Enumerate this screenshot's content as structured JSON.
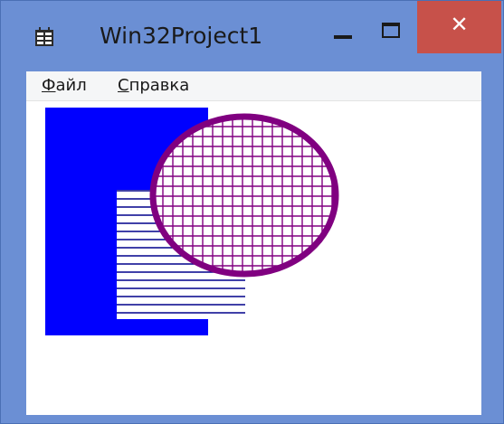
{
  "window": {
    "title": "Win32Project1",
    "icon": "application-icon",
    "controls": {
      "minimize": "minimize-icon",
      "maximize": "maximize-icon",
      "close_glyph": "✕"
    }
  },
  "menu": {
    "items": [
      {
        "mnemonic": "Ф",
        "rest": "айл"
      },
      {
        "mnemonic": "С",
        "rest": "правка"
      }
    ]
  },
  "colors": {
    "title_bar": "#6b8fd4",
    "close_button": "#c7514a",
    "rectangle_fill": "#0000ff",
    "hatch_lines": "#00008b",
    "ellipse": "#800080"
  }
}
